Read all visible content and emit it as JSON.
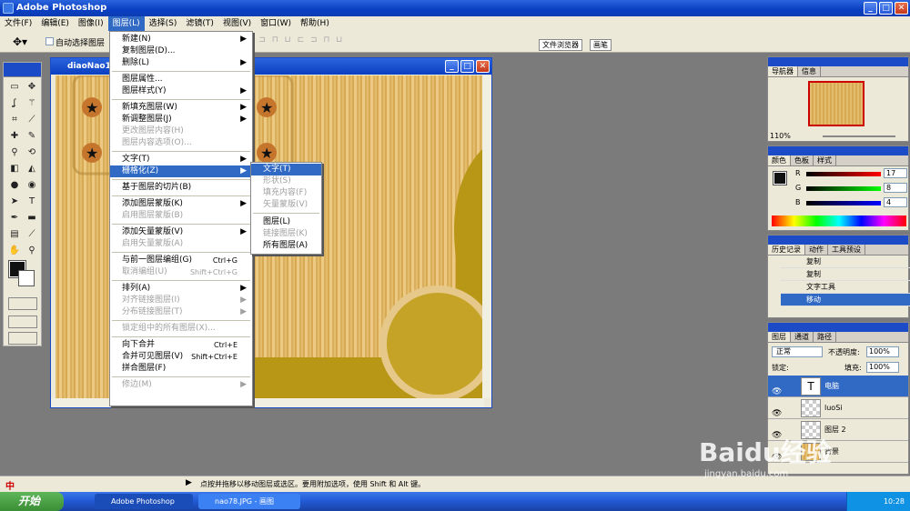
{
  "app": {
    "title": "Adobe Photoshop"
  },
  "menubar": {
    "items": [
      "文件(F)",
      "编辑(E)",
      "图像(I)",
      "图层(L)",
      "选择(S)",
      "滤镜(T)",
      "视图(V)",
      "窗口(W)",
      "帮助(H)"
    ]
  },
  "options": {
    "auto_select_label": "自动选择图层",
    "file_browser": "文件浏览器",
    "brushes": "画笔"
  },
  "document": {
    "title": "diaoNao1"
  },
  "layer_menu": {
    "items": [
      {
        "label": "新建(N)",
        "arrow": "▶"
      },
      {
        "label": "复制图层(D)...",
        "arrow": ""
      },
      {
        "label": "删除(L)",
        "arrow": "▶"
      },
      {
        "label": "图层属性...",
        "arrow": ""
      },
      {
        "label": "图层样式(Y)",
        "arrow": "▶"
      },
      {
        "label": "新填充图层(W)",
        "arrow": "▶"
      },
      {
        "label": "新调整图层(J)",
        "arrow": "▶"
      },
      {
        "label": "更改图层内容(H)",
        "arrow": ""
      },
      {
        "label": "图层内容选项(O)...",
        "arrow": ""
      },
      {
        "label": "文字(T)",
        "arrow": "▶"
      },
      {
        "label": "栅格化(Z)",
        "arrow": "▶"
      },
      {
        "label": "基于图层的切片(B)",
        "arrow": ""
      },
      {
        "label": "添加图层蒙版(K)",
        "arrow": "▶"
      },
      {
        "label": "启用图层蒙版(B)",
        "arrow": ""
      },
      {
        "label": "添加矢量蒙版(V)",
        "arrow": "▶"
      },
      {
        "label": "启用矢量蒙版(A)",
        "arrow": ""
      },
      {
        "label": "与前一图层编组(G)",
        "shortcut": "Ctrl+G"
      },
      {
        "label": "取消编组(U)",
        "shortcut": "Shift+Ctrl+G"
      },
      {
        "label": "排列(A)",
        "arrow": "▶"
      },
      {
        "label": "对齐链接图层(I)",
        "arrow": "▶"
      },
      {
        "label": "分布链接图层(T)",
        "arrow": "▶"
      },
      {
        "label": "锁定组中的所有图层(X)...",
        "arrow": ""
      },
      {
        "label": "向下合并",
        "shortcut": "Ctrl+E"
      },
      {
        "label": "合并可见图层(V)",
        "shortcut": "Shift+Ctrl+E"
      },
      {
        "label": "拼合图层(F)",
        "arrow": ""
      },
      {
        "label": "修边(M)",
        "arrow": "▶"
      }
    ]
  },
  "rasterize_menu": {
    "items": [
      "文字(T)",
      "形状(S)",
      "填充内容(F)",
      "矢量蒙版(V)",
      "图层(L)",
      "链接图层(K)",
      "所有图层(A)"
    ]
  },
  "navigator": {
    "tabs": [
      "导航器",
      "信息"
    ],
    "zoom": "110%"
  },
  "color": {
    "tabs": [
      "颜色",
      "色板",
      "样式"
    ],
    "r": "17",
    "g": "8",
    "b": "4",
    "r_label": "R",
    "g_label": "G",
    "b_label": "B"
  },
  "history": {
    "tabs": [
      "历史记录",
      "动作",
      "工具预设"
    ],
    "items": [
      "复制",
      "复制",
      "文字工具",
      "移动"
    ]
  },
  "layers": {
    "tabs": [
      "图层",
      "通道",
      "路径"
    ],
    "blend_mode": "正常",
    "opacity_label": "不透明度:",
    "opacity": "100%",
    "lock_label": "锁定:",
    "fill_label": "填充:",
    "fill": "100%",
    "rows": [
      {
        "name": "电脑"
      },
      {
        "name": "luoSi"
      },
      {
        "name": "图层 2"
      },
      {
        "name": "背景"
      }
    ]
  },
  "status": {
    "text": "点按并拖移以移动图层或选区。要用附加选项，使用 Shift 和 Alt 键。",
    "ime": "中"
  },
  "taskbar": {
    "start": "开始",
    "tasks": [
      "Adobe Photoshop",
      "nao78.JPG - 画图"
    ],
    "time": "10:28"
  },
  "watermark": {
    "text": "Baidu经验",
    "url": "jingyan.baidu.com"
  }
}
